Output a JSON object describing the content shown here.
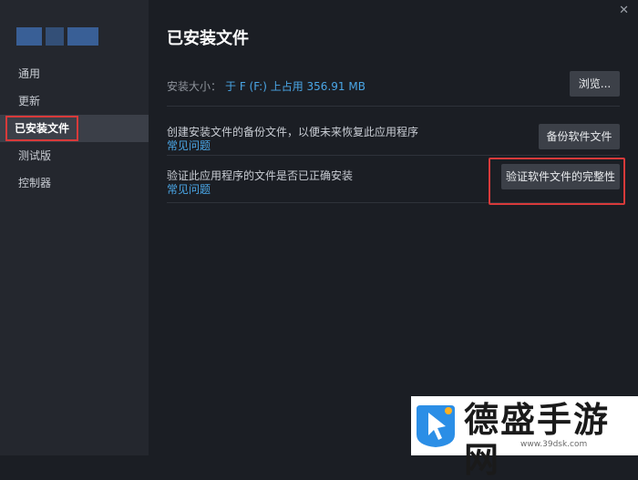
{
  "sidebar": {
    "items": [
      {
        "label": "通用"
      },
      {
        "label": "更新"
      },
      {
        "label": "已安装文件"
      },
      {
        "label": "测试版"
      },
      {
        "label": "控制器"
      }
    ]
  },
  "window": {
    "close_label": "✕"
  },
  "main": {
    "title": "已安装文件",
    "install_size_label": "安装大小：",
    "install_size_value": "于 F (F:) 上占用 356.91 MB",
    "browse_label": "浏览...",
    "backup_desc": "创建安装文件的备份文件，以便未来恢复此应用程序",
    "backup_link": "常见问题",
    "backup_button": "备份软件文件",
    "verify_desc": "验证此应用程序的文件是否已正确安装",
    "verify_link": "常见问题",
    "verify_button": "验证软件文件的完整性"
  },
  "watermark": {
    "name": "德盛手游网",
    "url": "www.39dsk.com"
  },
  "colors": {
    "accent": "#4aa6e6",
    "highlight": "#d83a3a",
    "sidebar_bg": "#24272e",
    "main_bg": "#1b1e24"
  }
}
